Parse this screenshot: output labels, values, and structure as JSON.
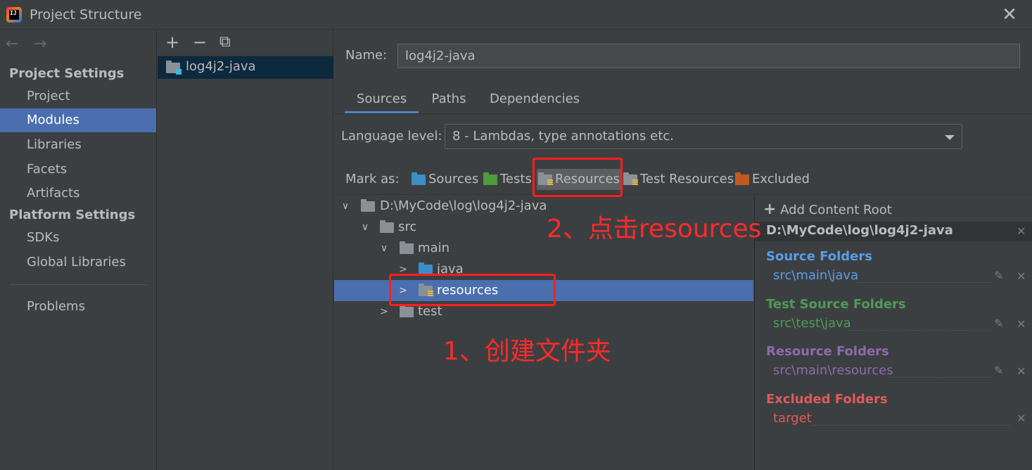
{
  "window": {
    "title": "Project Structure",
    "logo_text": "IJ",
    "close_glyph": "✕"
  },
  "nav": {
    "back_glyph": "←",
    "forward_glyph": "→",
    "project_settings_heading": "Project Settings",
    "project_items": [
      "Project",
      "Modules",
      "Libraries",
      "Facets",
      "Artifacts"
    ],
    "platform_settings_heading": "Platform Settings",
    "platform_items": [
      "SDKs",
      "Global Libraries"
    ],
    "problems": "Problems",
    "selected": "Modules"
  },
  "modules": {
    "toolbar": {
      "add": "+",
      "remove": "−",
      "copy": "⧉"
    },
    "items": [
      "log4j2-java"
    ]
  },
  "module_detail": {
    "name_label": "Name:",
    "name_value": "log4j2-java",
    "tabs": [
      "Sources",
      "Paths",
      "Dependencies"
    ],
    "active_tab": "Sources",
    "language_level_label": "Language level:",
    "language_level_value": "8 - Lambdas, type annotations etc.",
    "mark_as_label": "Mark as:",
    "mark_as_buttons": [
      {
        "label": "Sources",
        "color": "#3a8fc7"
      },
      {
        "label": "Tests",
        "color": "#4e9a3d"
      },
      {
        "label": "Resources",
        "color": "#8a9196"
      },
      {
        "label": "Test Resources",
        "color": "#8a9196"
      },
      {
        "label": "Excluded",
        "color": "#c15a21"
      }
    ]
  },
  "tree": {
    "root": "D:\\MyCode\\log\\log4j2-java",
    "src": "src",
    "main": "main",
    "java": "java",
    "resources": "resources",
    "test": "test",
    "expanded_glyph": "∨",
    "collapsed_glyph": ">"
  },
  "content_root": {
    "add_label": "Add Content Root",
    "add_glyph": "+",
    "root_path": "D:\\MyCode\\log\\log4j2-java",
    "source_heading": "Source Folders",
    "source_entry": "src\\main\\java",
    "source_color": "#5b9ce8",
    "test_heading": "Test Source Folders",
    "test_entry": "src\\test\\java",
    "test_color": "#4f9a5a",
    "resource_heading": "Resource Folders",
    "resource_entry": "src\\main\\resources",
    "resource_color": "#8c6bab",
    "excluded_heading": "Excluded Folders",
    "excluded_entry": "target",
    "excluded_color": "#e05a5a",
    "remove_glyph": "✕",
    "edit_glyph": "✎"
  },
  "annotations": {
    "step1": "1、创建文件夹",
    "step2": "2、点击resources",
    "color": "#ff1f1f"
  }
}
